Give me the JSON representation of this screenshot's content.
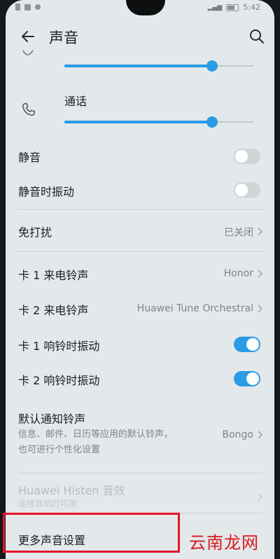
{
  "status_bar": {
    "time": "5:42"
  },
  "toolbar": {
    "title": "声音"
  },
  "volume": {
    "call_label": "通话",
    "media_level": 0.78,
    "call_level": 0.78
  },
  "settings": [
    {
      "id": "mute",
      "label": "静音",
      "control": "switch",
      "on": false
    },
    {
      "id": "vibrate-silent",
      "label": "静音时振动",
      "control": "switch",
      "on": false
    },
    {
      "id": "dnd",
      "label": "免打扰",
      "value": "已关闭",
      "control": "chevron"
    },
    {
      "id": "sim1-ringtone",
      "label": "卡 1 来电铃声",
      "value": "Honor",
      "control": "chevron"
    },
    {
      "id": "sim2-ringtone",
      "label": "卡 2 来电铃声",
      "value": "Huawei Tune Orchestral",
      "control": "chevron"
    },
    {
      "id": "sim1-vibrate",
      "label": "卡 1 响铃时振动",
      "control": "switch",
      "on": true
    },
    {
      "id": "sim2-vibrate",
      "label": "卡 2 响铃时振动",
      "control": "switch",
      "on": true
    }
  ],
  "notification_tone": {
    "label": "默认通知铃声",
    "sub_line1": "信息、邮件、日历等应用的默认铃声，",
    "sub_line2": "也可进行个性化设置",
    "value": "Bongo"
  },
  "histen": {
    "label": "Huawei Histen 音效",
    "sub": "连接耳机时可用"
  },
  "more_sound": {
    "label": "更多声音设置"
  },
  "watermark": "云南龙网"
}
